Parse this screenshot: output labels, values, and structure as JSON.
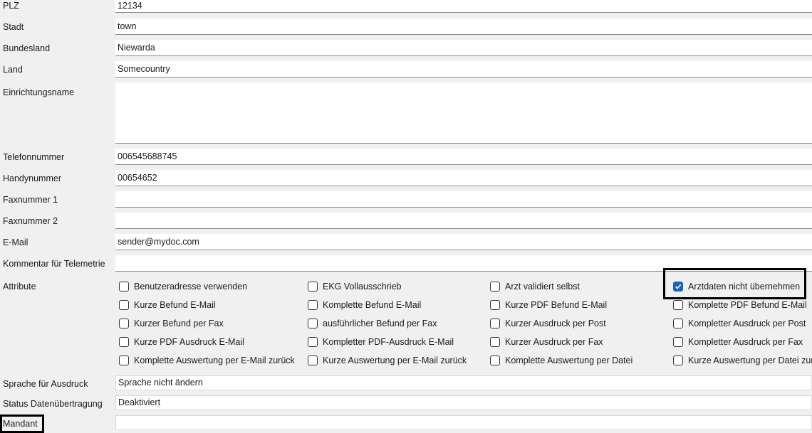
{
  "fields": {
    "plz": {
      "label": "PLZ",
      "value": "12134"
    },
    "stadt": {
      "label": "Stadt",
      "value": "town"
    },
    "bundesland": {
      "label": "Bundesland",
      "value": "Niewarda"
    },
    "land": {
      "label": "Land",
      "value": "Somecountry"
    },
    "einrichtungsname": {
      "label": "Einrichtungsname",
      "value": ""
    },
    "telefonnummer": {
      "label": "Telefonnummer",
      "value": "006545688745"
    },
    "handynummer": {
      "label": "Handynummer",
      "value": "00654652"
    },
    "faxnummer1": {
      "label": "Faxnummer 1",
      "value": ""
    },
    "faxnummer2": {
      "label": "Faxnummer 2",
      "value": ""
    },
    "email": {
      "label": "E-Mail",
      "value": "sender@mydoc.com"
    },
    "kommentar": {
      "label": "Kommentar für Telemetrie",
      "value": ""
    }
  },
  "attribute": {
    "label": "Attribute",
    "items": [
      {
        "label": "Benutzeradresse verwenden",
        "checked": false
      },
      {
        "label": "EKG Vollausschrieb",
        "checked": false
      },
      {
        "label": "Arzt validiert selbst",
        "checked": false
      },
      {
        "label": "Arztdaten nicht übernehmen",
        "checked": true
      },
      {
        "label": "Kurze Befund E-Mail",
        "checked": false
      },
      {
        "label": "Komplette Befund E-Mail",
        "checked": false
      },
      {
        "label": "Kurze PDF Befund E-Mail",
        "checked": false
      },
      {
        "label": "Komplette PDF Befund E-Mail",
        "checked": false
      },
      {
        "label": "Kurzer Befund per Fax",
        "checked": false
      },
      {
        "label": "ausführlicher Befund per Fax",
        "checked": false
      },
      {
        "label": "Kurzer Ausdruck per Post",
        "checked": false
      },
      {
        "label": "Kompletter Ausdruck per Post",
        "checked": false
      },
      {
        "label": "Kurze PDF Ausdruck E-Mail",
        "checked": false
      },
      {
        "label": "Kompletter PDF-Ausdruck E-Mail",
        "checked": false
      },
      {
        "label": "Kurzer Ausdruck per Fax",
        "checked": false
      },
      {
        "label": "Kompletter Ausdruck per Fax",
        "checked": false
      },
      {
        "label": "Komplette Auswertung per E-Mail zurück",
        "checked": false
      },
      {
        "label": "Kurze Auswertung per E-Mail zurück",
        "checked": false
      },
      {
        "label": "Komplette Auswertung per Datei",
        "checked": false
      },
      {
        "label": "Kurze Auswertung per Datei zurück",
        "checked": false
      }
    ]
  },
  "sprache": {
    "label": "Sprache für Ausdruck",
    "value": "Sprache nicht ändern"
  },
  "status": {
    "label": "Status Datenübertragung",
    "value": "Deaktiviert"
  },
  "mandant": {
    "label": "Mandant",
    "value": ""
  },
  "colors": {
    "checkbox_checked": "#1a62c6",
    "highlight": "#000000"
  }
}
